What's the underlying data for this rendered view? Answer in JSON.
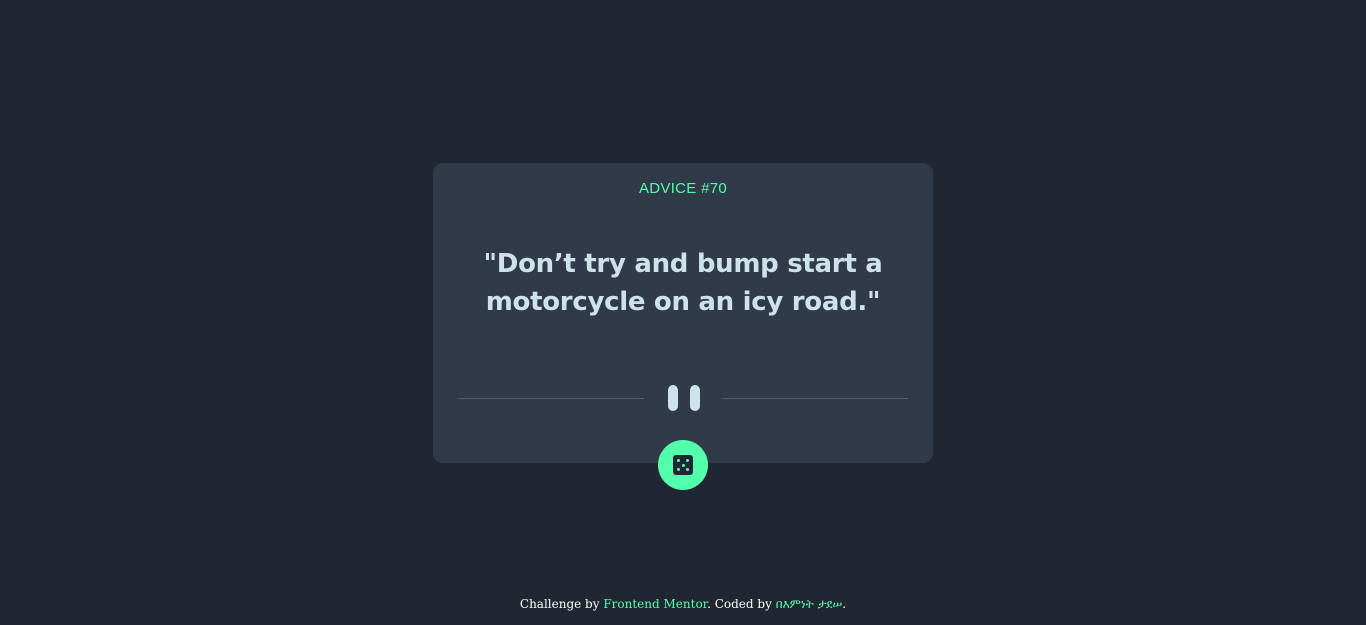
{
  "card": {
    "advice_label": "ADVICE #70",
    "advice_text": "\"Don’t try and bump start a motorcycle on an icy road.\""
  },
  "dice_button": {
    "icon": "dice-icon"
  },
  "divider": {
    "icon": "pause-icon"
  },
  "footer": {
    "prefix": "Challenge by ",
    "frontend_mentor": "Frontend Mentor",
    "middle": ". Coded by ",
    "author": "በእምነት ታደሠ",
    "suffix": "."
  },
  "colors": {
    "background": "#202632",
    "card": "#313A49",
    "accent": "#53FFAA",
    "text": "#CEE3E9",
    "divider": "#4F5D74"
  }
}
